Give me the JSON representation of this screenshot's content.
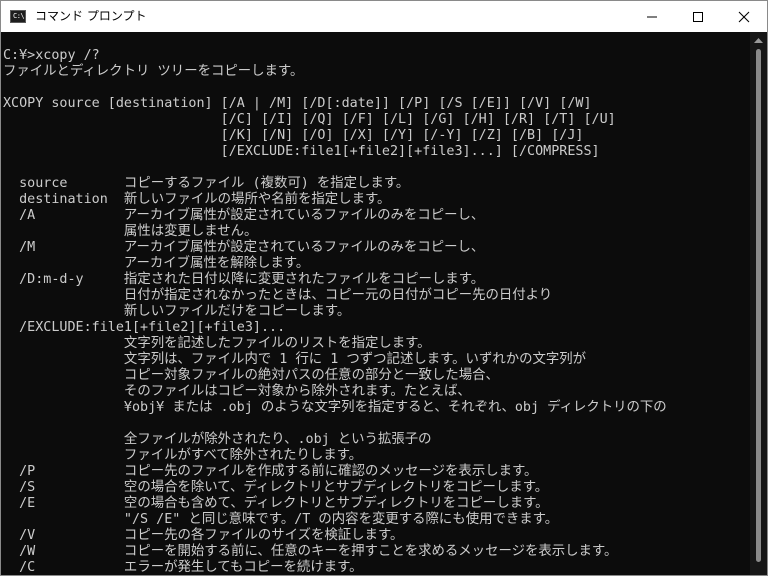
{
  "window": {
    "title": "コマンド プロンプト",
    "app_icon_text": "C:\\",
    "icons": {
      "app": "console-app-icon",
      "minimize": "minimize-icon",
      "maximize": "maximize-icon",
      "close": "close-icon",
      "scroll": "scroll-up-arrow-icon"
    }
  },
  "colors": {
    "background": "#0c0c0c",
    "text": "#cccccc",
    "titlebar": "#ffffff"
  },
  "console": {
    "lines": [
      "C:¥>xcopy /?",
      "ファイルとディレクトリ ツリーをコピーします。",
      "",
      "XCOPY source [destination] [/A | /M] [/D[:date]] [/P] [/S [/E]] [/V] [/W]",
      "                           [/C] [/I] [/Q] [/F] [/L] [/G] [/H] [/R] [/T] [/U]",
      "                           [/K] [/N] [/O] [/X] [/Y] [/-Y] [/Z] [/B] [/J]",
      "                           [/EXCLUDE:file1[+file2][+file3]...] [/COMPRESS]",
      "",
      "  source       コピーするファイル (複数可) を指定します。",
      "  destination  新しいファイルの場所や名前を指定します。",
      "  /A           アーカイブ属性が設定されているファイルのみをコピーし、",
      "               属性は変更しません。",
      "  /M           アーカイブ属性が設定されているファイルのみをコピーし、",
      "               アーカイブ属性を解除します。",
      "  /D:m-d-y     指定された日付以降に変更されたファイルをコピーします。",
      "               日付が指定されなかったときは、コピー元の日付がコピー先の日付より",
      "               新しいファイルだけをコピーします。",
      "  /EXCLUDE:file1[+file2][+file3]...",
      "               文字列を記述したファイルのリストを指定します。",
      "               文字列は、ファイル内で 1 行に 1 つずつ記述します。いずれかの文字列が",
      "               コピー対象ファイルの絶対パスの任意の部分と一致した場合、",
      "               そのファイルはコピー対象から除外されます。たとえば、",
      "               ¥obj¥ または .obj のような文字列を指定すると、それぞれ、obj ディレクトリの下の",
      "",
      "               全ファイルが除外されたり、.obj という拡張子の",
      "               ファイルがすべて除外されたりします。",
      "  /P           コピー先のファイルを作成する前に確認のメッセージを表示します。",
      "  /S           空の場合を除いて、ディレクトリとサブディレクトリをコピーします。",
      "  /E           空の場合も含めて、ディレクトリとサブディレクトリをコピーします。",
      "               \"/S /E\" と同じ意味です。/T の内容を変更する際にも使用できます。",
      "  /V           コピー先の各ファイルのサイズを検証します。",
      "  /W           コピーを開始する前に、任意のキーを押すことを求めるメッセージを表示します。",
      "  /C           エラーが発生してもコピーを続けます。"
    ]
  }
}
